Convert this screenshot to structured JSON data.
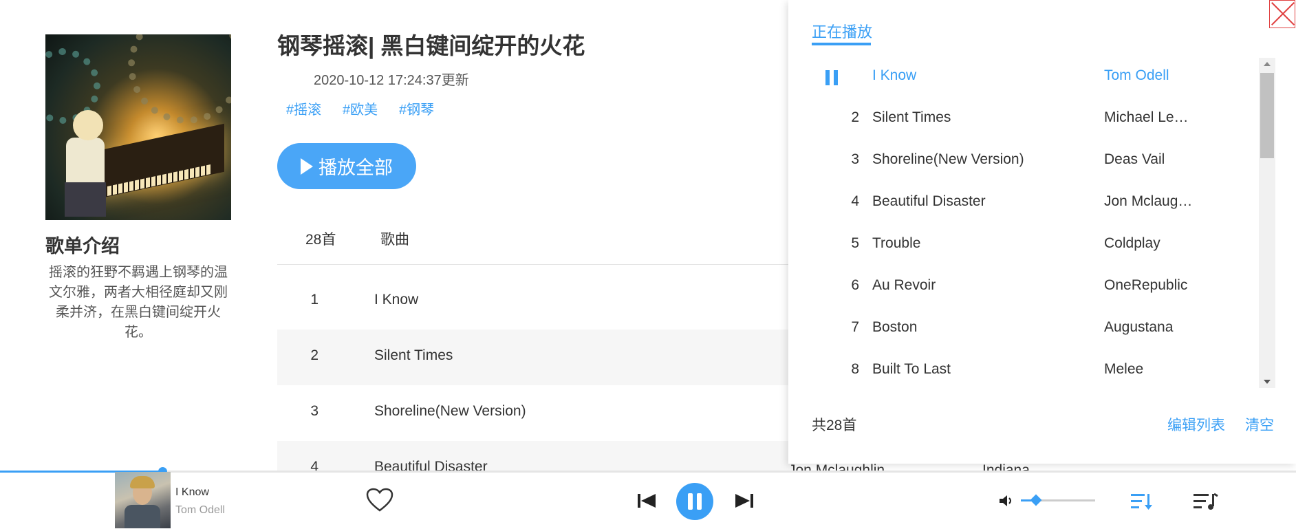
{
  "playlist": {
    "title": "钢琴摇滚| 黑白键间绽开的火花",
    "updated": "2020-10-12 17:24:37更新",
    "tags": [
      "#摇滚",
      "#欧美",
      "#钢琴"
    ],
    "play_all_label": "播放全部",
    "intro_title": "歌单介绍",
    "intro_text": "摇滚的狂野不羁遇上钢琴的温文尔雅，两者大相径庭却又刚柔并济，在黑白键间绽开火花。"
  },
  "table": {
    "count_header": "28首",
    "song_header": "歌曲",
    "rows": [
      {
        "num": "1",
        "name": "I Know"
      },
      {
        "num": "2",
        "name": "Silent Times"
      },
      {
        "num": "3",
        "name": "Shoreline(New Version)"
      },
      {
        "num": "4",
        "name": "Beautiful Disaster",
        "artist": "Jon Mclaughlin",
        "album": "Indiana"
      }
    ]
  },
  "now_playing_panel": {
    "tab_label": "正在播放",
    "rows": [
      {
        "num": "",
        "name": "I Know",
        "artist": "Tom Odell"
      },
      {
        "num": "2",
        "name": "Silent Times",
        "artist": "Michael Le…"
      },
      {
        "num": "3",
        "name": "Shoreline(New Version)",
        "artist": "Deas Vail"
      },
      {
        "num": "4",
        "name": "Beautiful Disaster",
        "artist": "Jon Mclaug…"
      },
      {
        "num": "5",
        "name": "Trouble",
        "artist": "Coldplay"
      },
      {
        "num": "6",
        "name": "Au Revoir",
        "artist": "OneRepublic"
      },
      {
        "num": "7",
        "name": "Boston",
        "artist": "Augustana"
      },
      {
        "num": "8",
        "name": "Built To Last",
        "artist": "Melee"
      }
    ],
    "total": "共28首",
    "edit_label": "编辑列表",
    "clear_label": "清空"
  },
  "player": {
    "song": "I Know",
    "artist": "Tom Odell",
    "progress_fraction": 0.125,
    "volume_fraction": 0.2
  },
  "colors": {
    "accent": "#3a9ff5",
    "close": "#e04040"
  },
  "icons": [
    "pause-icon",
    "close-icon",
    "heart-icon",
    "previous-icon",
    "pause-icon",
    "next-icon",
    "volume-icon",
    "playlist-queue-icon",
    "lyrics-list-icon"
  ]
}
